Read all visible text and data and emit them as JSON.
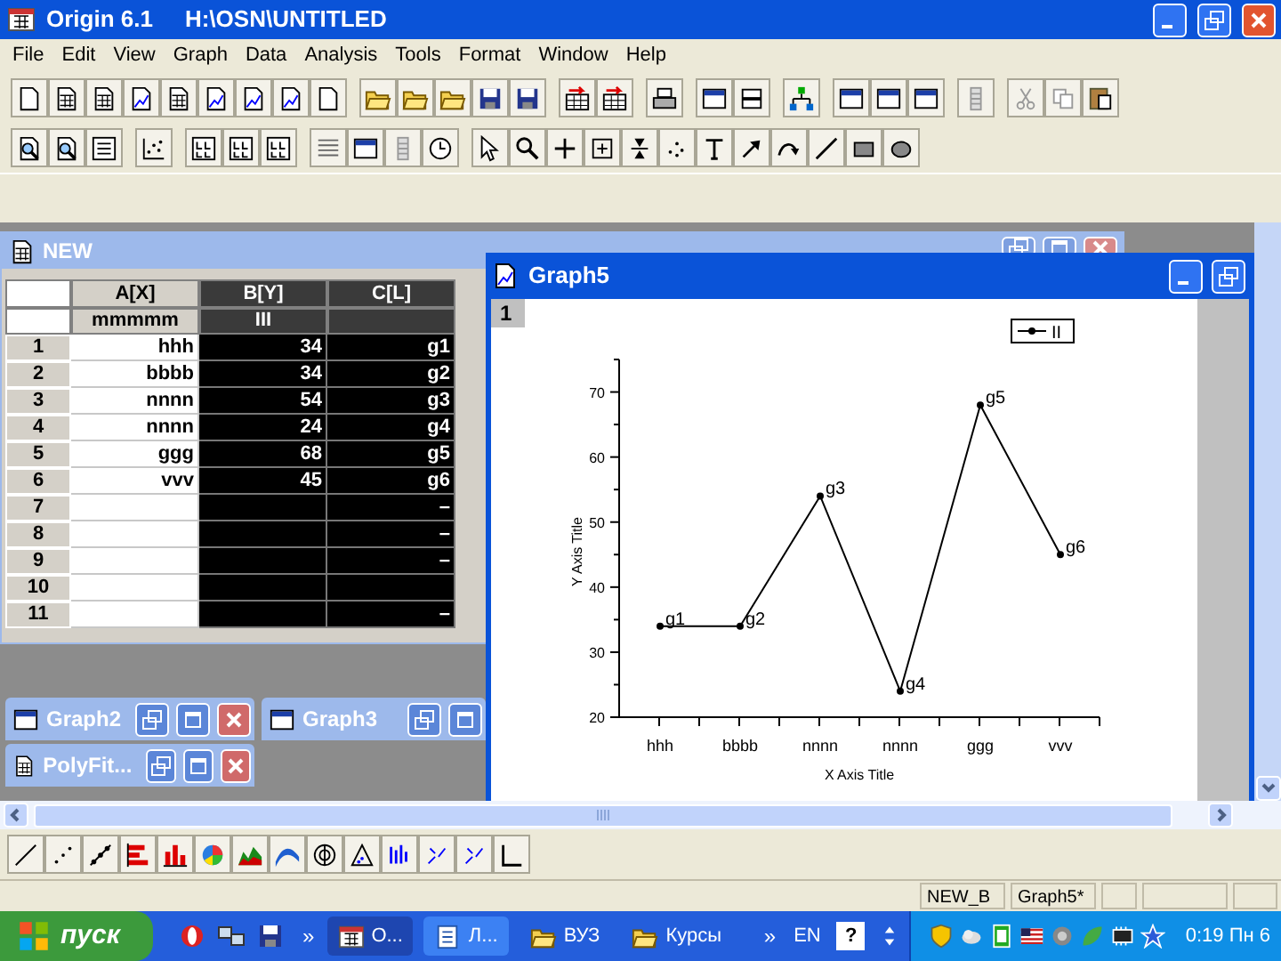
{
  "window": {
    "app_name": "Origin 6.1",
    "file_path": "H:\\OSN\\UNTITLED"
  },
  "menu": [
    {
      "label": "File"
    },
    {
      "label": "Edit"
    },
    {
      "label": "View"
    },
    {
      "label": "Graph"
    },
    {
      "label": "Data"
    },
    {
      "label": "Analysis"
    },
    {
      "label": "Tools"
    },
    {
      "label": "Format"
    },
    {
      "label": "Window"
    },
    {
      "label": "Help"
    }
  ],
  "worksheet": {
    "title": "NEW",
    "columns": [
      {
        "name": "A[X]",
        "long_name": "mmmmm",
        "selected": false
      },
      {
        "name": "B[Y]",
        "long_name": "III",
        "selected": true
      },
      {
        "name": "C[L]",
        "selected": true
      }
    ],
    "rows": [
      {
        "index": "1",
        "a": "hhh",
        "b": "34",
        "c": "g1"
      },
      {
        "index": "2",
        "a": "bbbb",
        "b": "34",
        "c": "g2"
      },
      {
        "index": "3",
        "a": "nnnn",
        "b": "54",
        "c": "g3"
      },
      {
        "index": "4",
        "a": "nnnn",
        "b": "24",
        "c": "g4"
      },
      {
        "index": "5",
        "a": "ggg",
        "b": "68",
        "c": "g5"
      },
      {
        "index": "6",
        "a": "vvv",
        "b": "45",
        "c": "g6"
      },
      {
        "index": "7",
        "c": "–"
      },
      {
        "index": "8",
        "c": "–"
      },
      {
        "index": "9",
        "c": "–"
      },
      {
        "index": "10"
      },
      {
        "index": "11",
        "c": "–"
      }
    ]
  },
  "graph": {
    "title": "Graph5",
    "layer": "1",
    "chart_data": {
      "type": "line",
      "xlabel": "X Axis Title",
      "ylabel": "Y Axis Title",
      "categories": [
        "hhh",
        "bbbb",
        "nnnn",
        "nnnn",
        "ggg",
        "vvv"
      ],
      "series": [
        {
          "name": "II",
          "color": "#000000",
          "marker": "circle",
          "values": [
            34,
            34,
            54,
            24,
            68,
            45
          ]
        }
      ],
      "value_labels": [
        "g1",
        "g2",
        "g3",
        "g4",
        "g5",
        "g6"
      ],
      "ylim": [
        20,
        75
      ],
      "yticks": [
        20,
        30,
        40,
        50,
        60,
        70
      ]
    }
  },
  "minimized_windows": [
    {
      "title": "Graph2",
      "kind": "graph"
    },
    {
      "title": "Graph3",
      "kind": "graph"
    },
    {
      "title": "PolyFit...",
      "kind": "worksheet"
    }
  ],
  "status_bar": [
    "NEW_B",
    "Graph5*"
  ],
  "taskbar": {
    "start": "пуск",
    "overflow": "»",
    "tasks": [
      {
        "label": "O...",
        "kind": "app",
        "selected": true
      },
      {
        "label": "Л...",
        "kind": "document",
        "selected": false
      },
      {
        "label": "ВУЗ",
        "kind": "folder",
        "selected": false
      },
      {
        "label": "Курсы",
        "kind": "folder",
        "selected": false
      }
    ],
    "overflow_2": "»",
    "language": "EN",
    "help": "?",
    "clock": "0:19 Пн 6"
  }
}
